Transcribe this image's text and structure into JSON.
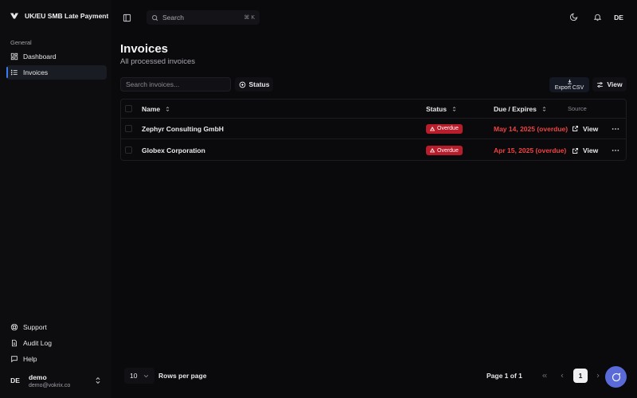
{
  "app": {
    "title": "UK/EU SMB Late Payment A"
  },
  "sidebar": {
    "group_label": "General",
    "items": [
      {
        "label": "Dashboard",
        "icon": "layout-dashboard-icon"
      },
      {
        "label": "Invoices",
        "icon": "list-icon",
        "active": true
      }
    ],
    "bottom_items": [
      {
        "label": "Support",
        "icon": "life-buoy-icon"
      },
      {
        "label": "Audit Log",
        "icon": "file-text-icon"
      },
      {
        "label": "Help",
        "icon": "message-square-icon"
      }
    ],
    "user": {
      "initials": "DE",
      "name": "demo",
      "email": "demo@vokrix.co"
    }
  },
  "topbar": {
    "search_label": "Search",
    "search_shortcut": "⌘ K",
    "avatar_initials": "DE"
  },
  "page": {
    "title": "Invoices",
    "subtitle": "All processed invoices"
  },
  "toolbar": {
    "search_placeholder": "Search invoices...",
    "status_label": "Status",
    "export_label": "Export CSV",
    "view_label": "View"
  },
  "table": {
    "columns": {
      "name": "Name",
      "status": "Status",
      "due": "Due / Expires",
      "source": "Source"
    },
    "rows": [
      {
        "name": "Zephyr Consulting GmbH",
        "status": "Overdue",
        "due": "May 14, 2025 (overdue)",
        "action": "View"
      },
      {
        "name": "Globex Corporation",
        "status": "Overdue",
        "due": "Apr 15, 2025 (overdue)",
        "action": "View"
      }
    ]
  },
  "pagination": {
    "rows_per_page_value": "10",
    "rows_per_page_label": "Rows per page",
    "page_info": "Page 1 of 1",
    "current_page": "1"
  },
  "colors": {
    "accent": "#3b7bf0",
    "overdue_badge": "#b91c2a",
    "overdue_text": "#ef4444",
    "chat_fab": "#5a6ad8"
  }
}
